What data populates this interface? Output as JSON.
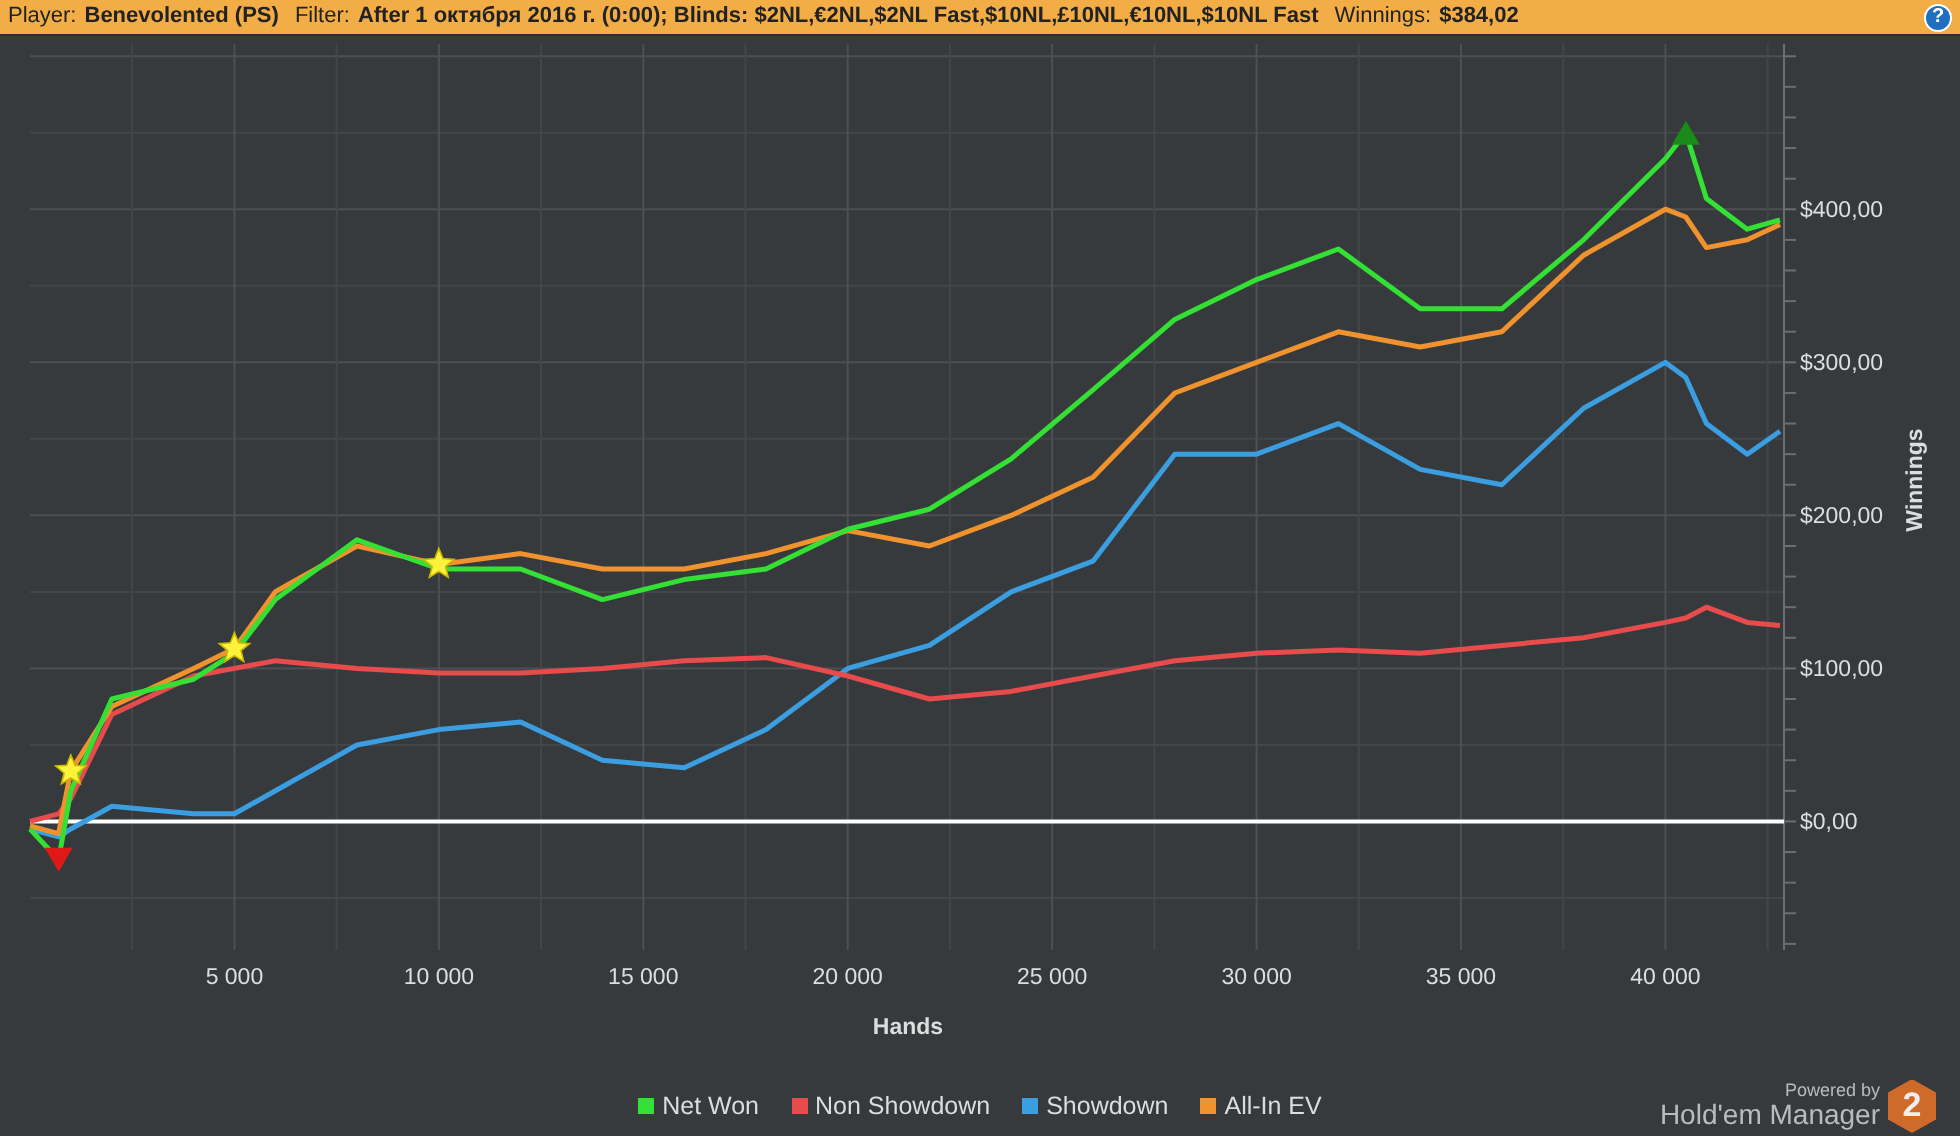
{
  "header": {
    "fields": [
      {
        "label": "Player:",
        "value": "Benevolented (PS)"
      },
      {
        "label": "Filter:",
        "value": "After 1 октября 2016 г. (0:00); Blinds: $2NL,€2NL,$2NL Fast,$10NL,£10NL,€10NL,$10NL Fast"
      },
      {
        "label": "Winnings:",
        "value": "$384,02"
      }
    ],
    "help_button": "?"
  },
  "chart": {
    "chart_data": {
      "type": "line",
      "xlabel": "Hands",
      "ylabel": "Winnings",
      "x": [
        0,
        700,
        1000,
        2000,
        4000,
        5000,
        6000,
        8000,
        10000,
        12000,
        14000,
        16000,
        18000,
        20000,
        22000,
        24000,
        26000,
        28000,
        30000,
        32000,
        34000,
        36000,
        38000,
        40000,
        40500,
        41000,
        42000,
        42800
      ],
      "series": [
        {
          "name": "Net Won",
          "color": "#33e033",
          "values": [
            -5,
            -25,
            20,
            80,
            93,
            110,
            145,
            184,
            165,
            165,
            145,
            158,
            165,
            191,
            204,
            237,
            282,
            328,
            354,
            374,
            335,
            335,
            380,
            433,
            450,
            407,
            387,
            393
          ]
        },
        {
          "name": "Non Showdown",
          "color": "#e84b4b",
          "values": [
            0,
            5,
            15,
            70,
            95,
            100,
            105,
            100,
            97,
            97,
            100,
            105,
            107,
            95,
            80,
            85,
            95,
            105,
            110,
            112,
            110,
            115,
            120,
            130,
            133,
            140,
            130,
            128
          ]
        },
        {
          "name": "Showdown",
          "color": "#3a9ee0",
          "values": [
            -5,
            -10,
            -5,
            10,
            5,
            5,
            20,
            50,
            60,
            65,
            40,
            35,
            60,
            100,
            115,
            150,
            170,
            240,
            240,
            260,
            230,
            220,
            270,
            300,
            290,
            260,
            240,
            255
          ]
        },
        {
          "name": "All-In EV",
          "color": "#f0922e",
          "values": [
            -3,
            -8,
            33,
            75,
            100,
            113,
            150,
            180,
            168,
            175,
            165,
            165,
            175,
            190,
            180,
            200,
            225,
            280,
            300,
            320,
            310,
            320,
            370,
            400,
            395,
            375,
            380,
            390
          ]
        }
      ],
      "xlim": [
        0,
        42900
      ],
      "ylim": [
        -84,
        508
      ],
      "xticks": [
        {
          "value": 5000,
          "label": "5 000"
        },
        {
          "value": 10000,
          "label": "10 000"
        },
        {
          "value": 15000,
          "label": "15 000"
        },
        {
          "value": 20000,
          "label": "20 000"
        },
        {
          "value": 25000,
          "label": "25 000"
        },
        {
          "value": 30000,
          "label": "30 000"
        },
        {
          "value": 35000,
          "label": "35 000"
        },
        {
          "value": 40000,
          "label": "40 000"
        }
      ],
      "yticks": [
        {
          "value": 0,
          "label": "$0,00"
        },
        {
          "value": 100,
          "label": "$100,00"
        },
        {
          "value": 200,
          "label": "$200,00"
        },
        {
          "value": 300,
          "label": "$300,00"
        },
        {
          "value": 400,
          "label": "$400,00"
        }
      ],
      "grid": true
    },
    "markers": [
      {
        "kind": "star"
      },
      {
        "kind": "star"
      },
      {
        "kind": "star"
      },
      {
        "kind": "low"
      },
      {
        "kind": "high"
      }
    ]
  },
  "branding": {
    "caption": "Powered by",
    "product": "Hold'em Manager",
    "badge": "2"
  }
}
